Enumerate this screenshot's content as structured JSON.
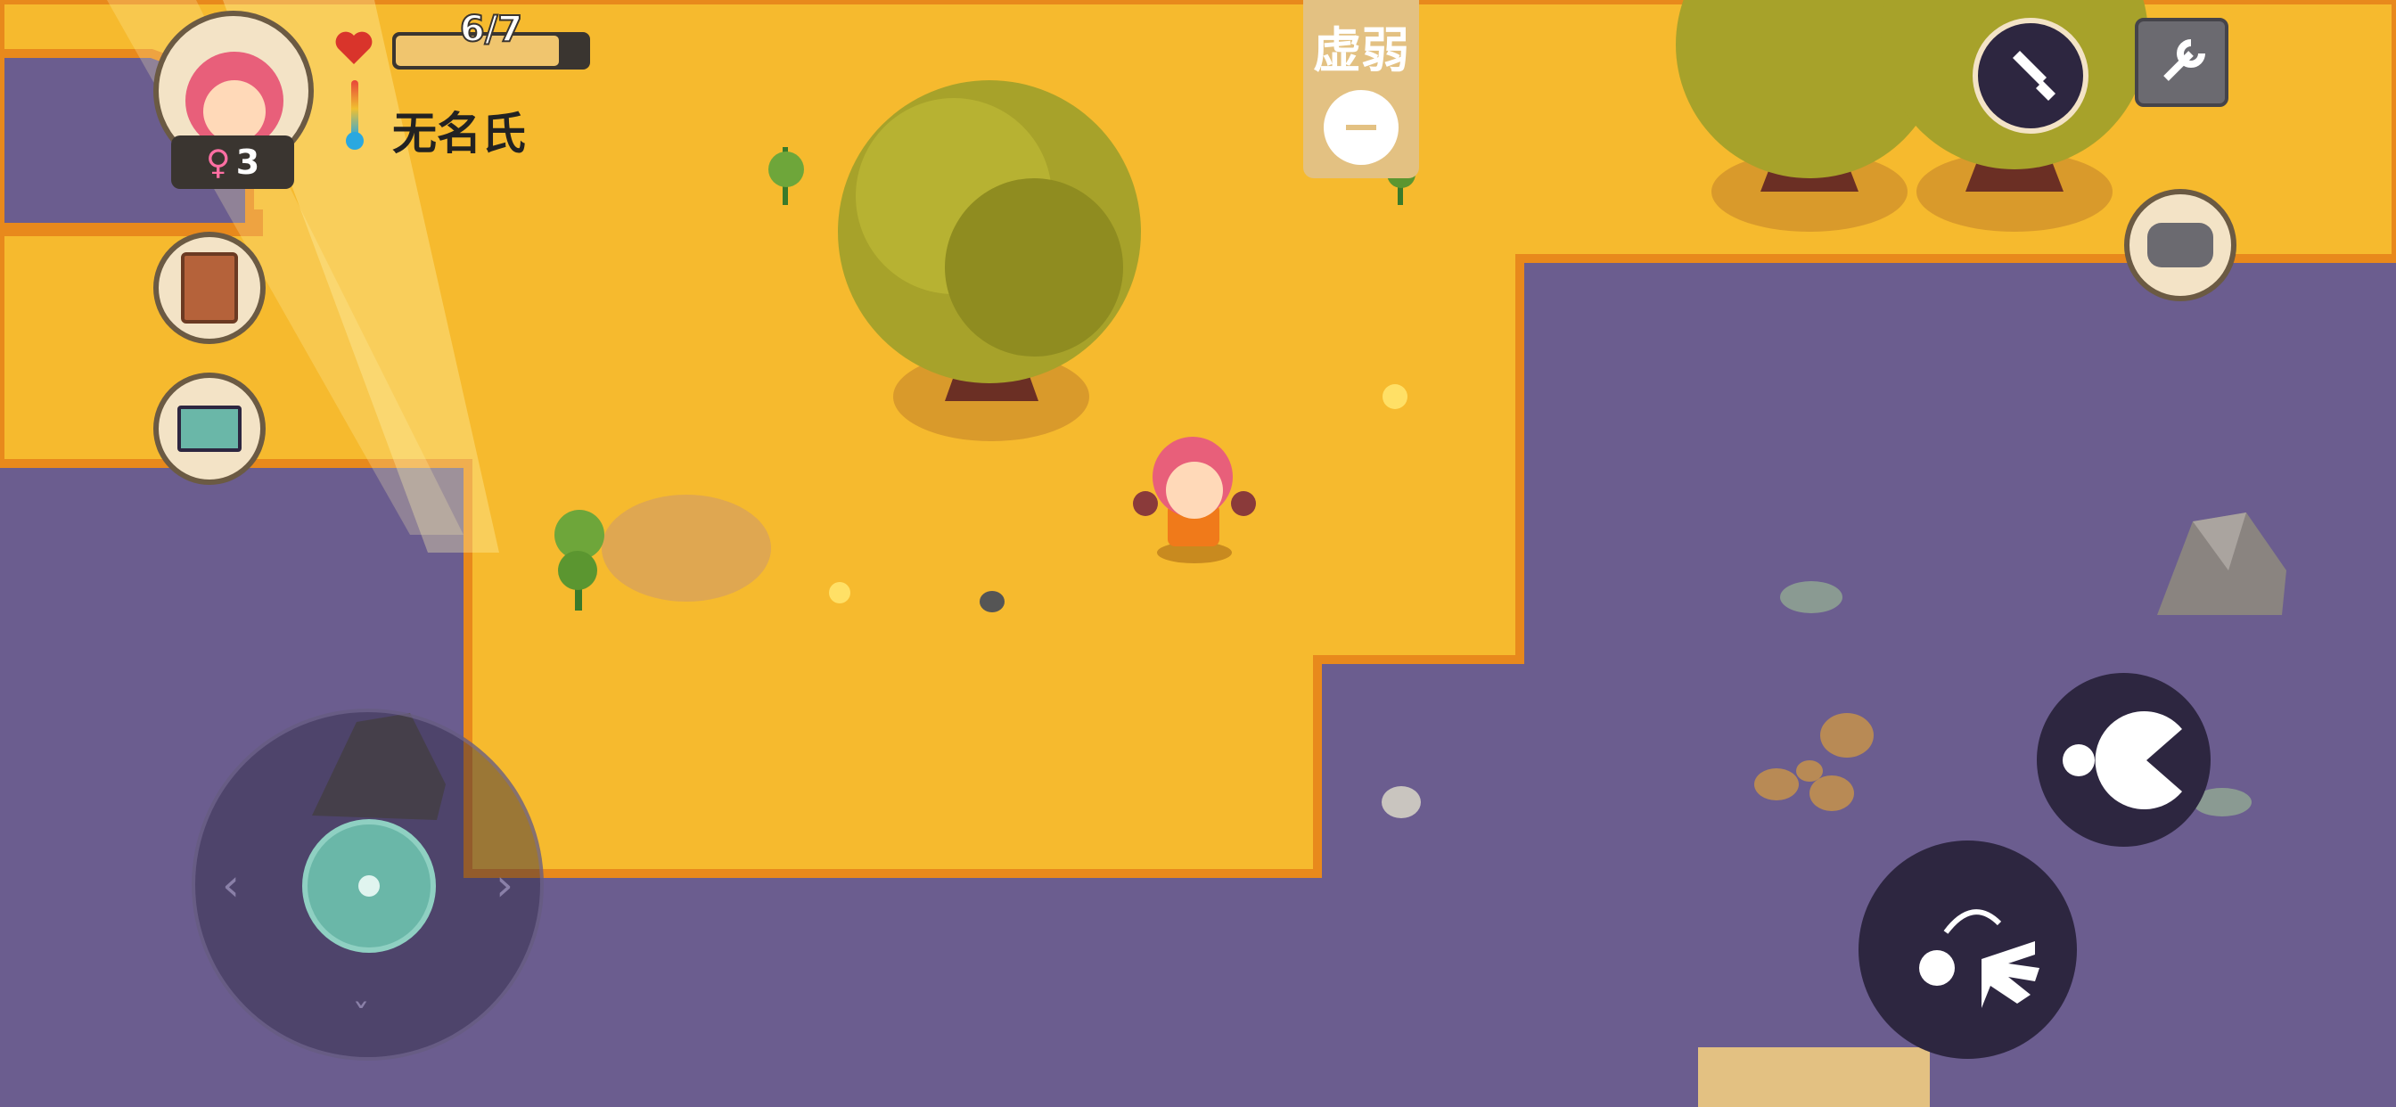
{
  "player": {
    "health_text": "6/7",
    "health_fraction": 0.857,
    "name": "无名氏",
    "gender_symbol": "♀",
    "age": "3",
    "temperature_level": 0.55
  },
  "status": {
    "label": "虚弱",
    "icon": "weak-face-icon"
  },
  "colors": {
    "ground_yellow": "#f6ba2e",
    "ground_purple": "#6b5d8f",
    "health_fill": "#f0c56e",
    "heart": "#d9342b",
    "button_dark": "#2d2640"
  },
  "controls": {
    "joystick": "movement-joystick",
    "eat_button": "eat-icon",
    "grab_button": "grab-throw-icon",
    "sword_button": "sword-icon",
    "settings_button": "wrench-icon",
    "chat_button": "chat-bubble-icon",
    "recipe_book_button": "book-icon",
    "shop_button": "cart-icon"
  }
}
